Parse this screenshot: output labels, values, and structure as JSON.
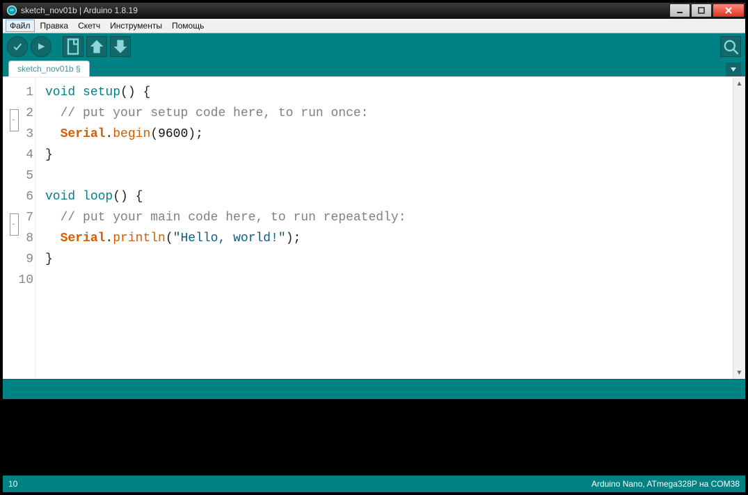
{
  "window": {
    "title": "sketch_nov01b | Arduino 1.8.19"
  },
  "menu": {
    "items": [
      "Файл",
      "Правка",
      "Скетч",
      "Инструменты",
      "Помощь"
    ],
    "active": 0
  },
  "tab": {
    "label": "sketch_nov01b §"
  },
  "code": {
    "lines": [
      {
        "n": "1",
        "fold": true,
        "seg": [
          [
            "kw",
            "void"
          ],
          [
            "",
            " "
          ],
          [
            "kw",
            "setup"
          ],
          [
            "",
            "() {"
          ]
        ]
      },
      {
        "n": "2",
        "seg": [
          [
            "",
            "  "
          ],
          [
            "cm",
            "// put your setup code here, to run once:"
          ]
        ]
      },
      {
        "n": "3",
        "seg": [
          [
            "",
            "  "
          ],
          [
            "kw2",
            "Serial"
          ],
          [
            "",
            "."
          ],
          [
            "fn",
            "begin"
          ],
          [
            "",
            "("
          ],
          [
            "num",
            "9600"
          ],
          [
            "",
            ");"
          ]
        ]
      },
      {
        "n": "4",
        "seg": [
          [
            "",
            "}"
          ]
        ]
      },
      {
        "n": "5",
        "seg": [
          [
            "",
            ""
          ]
        ]
      },
      {
        "n": "6",
        "fold": true,
        "seg": [
          [
            "kw",
            "void"
          ],
          [
            "",
            " "
          ],
          [
            "kw",
            "loop"
          ],
          [
            "",
            "() {"
          ]
        ]
      },
      {
        "n": "7",
        "seg": [
          [
            "",
            "  "
          ],
          [
            "cm",
            "// put your main code here, to run repeatedly:"
          ]
        ]
      },
      {
        "n": "8",
        "seg": [
          [
            "",
            "  "
          ],
          [
            "kw2",
            "Serial"
          ],
          [
            "",
            "."
          ],
          [
            "fn",
            "println"
          ],
          [
            "",
            "("
          ],
          [
            "str",
            "\"Hello, world!\""
          ],
          [
            "",
            ");"
          ]
        ]
      },
      {
        "n": "9",
        "seg": [
          [
            "",
            "}"
          ]
        ]
      },
      {
        "n": "10",
        "seg": [
          [
            "",
            ""
          ]
        ]
      }
    ]
  },
  "footer": {
    "line": "10",
    "board": "Arduino Nano, ATmega328P на COM38"
  }
}
